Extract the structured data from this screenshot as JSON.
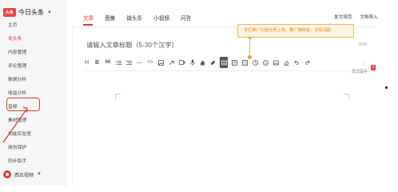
{
  "brand": {
    "logo_text": "头条",
    "name": "今日头条",
    "caret": "▲"
  },
  "sidebar": {
    "items": [
      {
        "label": "主页",
        "active": false
      },
      {
        "label": "发头条",
        "active": true
      },
      {
        "label": "内容管理",
        "active": false
      },
      {
        "label": "评论管理",
        "active": false
      },
      {
        "label": "数据分析",
        "active": false
      },
      {
        "label": "收益分析",
        "active": false
      },
      {
        "label": "音频",
        "active": false
      },
      {
        "label": "素材管理",
        "active": false
      },
      {
        "label": "功能实验室",
        "active": false
      },
      {
        "label": "原创保护",
        "active": false
      },
      {
        "label": "同步助手",
        "active": false
      }
    ],
    "footer": {
      "label": "西瓜视频",
      "caret": "▼"
    }
  },
  "header": {
    "tabs": [
      {
        "label": "文章",
        "active": true
      },
      {
        "label": "图集",
        "active": false
      },
      {
        "label": "微头条",
        "active": false
      },
      {
        "label": "小视频",
        "active": false
      },
      {
        "label": "问答",
        "active": false
      }
    ],
    "links": [
      "发文规范",
      "文档导入"
    ]
  },
  "editor": {
    "title_placeholder": "请输入文章标题（5-30个汉字）",
    "title_count": "0/30",
    "tooltip": "专栏推广功能全新上线，推广赚佣金，详情请戳",
    "toolbar_text_buttons": {
      "heading": "H",
      "bold": "B",
      "quote": "66",
      "hr": "—",
      "code": "<>"
    },
    "helper_label": "发文助手",
    "helper_badge": "1"
  },
  "icons": [
    "heading-icon",
    "bold-icon",
    "quote-icon",
    "ordered-list-icon",
    "unordered-list-icon",
    "divider-icon",
    "code-icon",
    "image-icon",
    "link-icon",
    "video-icon",
    "audio-icon",
    "vote-icon",
    "column-promo-icon",
    "product-card-icon",
    "mini-program-icon",
    "location-icon",
    "emoji-icon",
    "music-icon",
    "eraser-icon",
    "undo-icon",
    "redo-icon",
    "more-icon"
  ],
  "colors": {
    "accent": "#e8363a",
    "highlight_box": "#e23b31",
    "tooltip_bg": "#fdf3e1",
    "tooltip_border": "#f0b45a",
    "tooltip_text": "#e88a1a",
    "sidebar_bg": "#f5f6f7"
  }
}
